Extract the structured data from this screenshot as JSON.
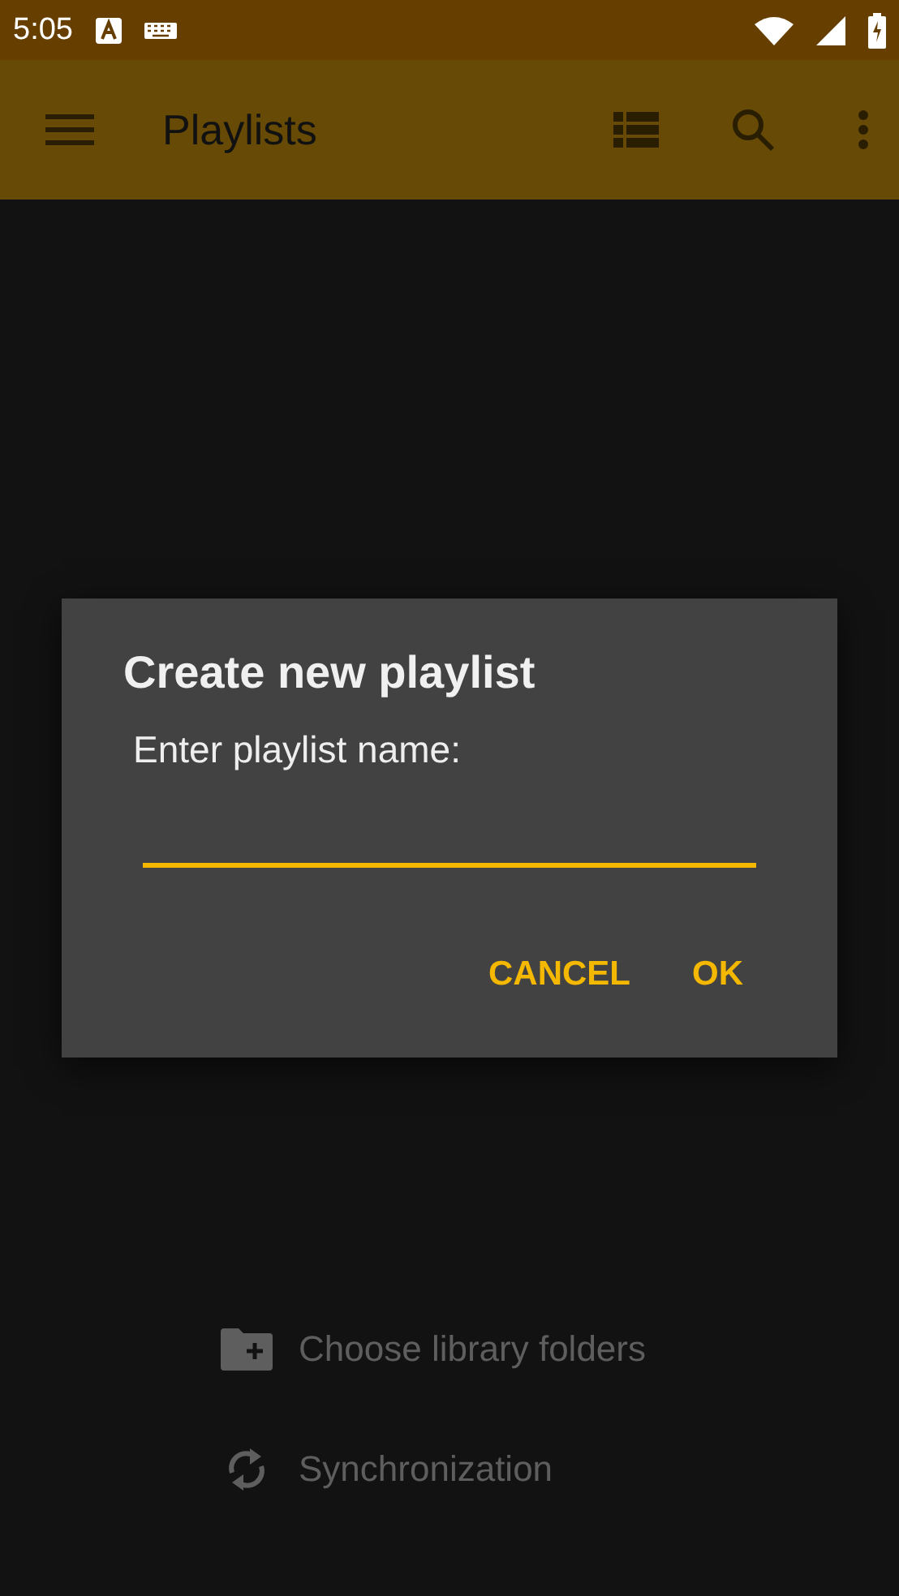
{
  "status_bar": {
    "time": "5:05"
  },
  "toolbar": {
    "title": "Playlists"
  },
  "empty_actions": [
    {
      "kind": "folder",
      "label": "Choose library folders"
    },
    {
      "kind": "sync",
      "label": "Synchronization"
    }
  ],
  "dialog": {
    "title": "Create new playlist",
    "prompt": "Enter playlist name:",
    "field": {
      "focused": true
    },
    "buttons": [
      "CANCEL",
      "OK"
    ]
  }
}
